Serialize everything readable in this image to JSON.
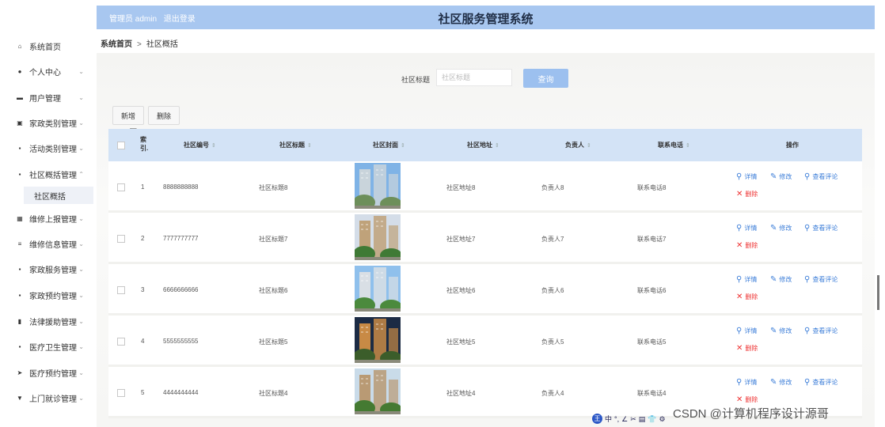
{
  "header": {
    "admin_label": "管理员 admin",
    "logout": "退出登录",
    "title": "社区服务管理系统"
  },
  "breadcrumb": {
    "home": "系统首页",
    "separator": ">",
    "current": "社区概括"
  },
  "sidebar": {
    "items": [
      {
        "label": "系统首页",
        "icon": "home-icon",
        "glyph": "⌂",
        "chevron": ""
      },
      {
        "label": "个人中心",
        "icon": "user-icon",
        "glyph": "●",
        "chevron": "⌄"
      },
      {
        "label": "用户管理",
        "icon": "users-icon",
        "glyph": "▬",
        "chevron": "⌄"
      },
      {
        "label": "家政类别管理",
        "icon": "clipboard-icon",
        "glyph": "▣",
        "chevron": "⌄"
      },
      {
        "label": "活动类别管理",
        "icon": "grid-icon",
        "glyph": "▪",
        "chevron": "⌄"
      },
      {
        "label": "社区概括管理",
        "icon": "grid-icon",
        "glyph": "▪",
        "chevron": "⌃"
      },
      {
        "label": "维修上报管理",
        "icon": "table-icon",
        "glyph": "▦",
        "chevron": "⌄"
      },
      {
        "label": "维修信息管理",
        "icon": "sliders-icon",
        "glyph": "≡",
        "chevron": "⌄"
      },
      {
        "label": "家政服务管理",
        "icon": "grid-icon",
        "glyph": "▪",
        "chevron": "⌄"
      },
      {
        "label": "家政预约管理",
        "icon": "grid-icon",
        "glyph": "▪",
        "chevron": "⌄"
      },
      {
        "label": "法律援助管理",
        "icon": "chart-icon",
        "glyph": "▮",
        "chevron": "⌄"
      },
      {
        "label": "医疗卫生管理",
        "icon": "grid-icon",
        "glyph": "▪",
        "chevron": "⌄"
      },
      {
        "label": "医疗预约管理",
        "icon": "send-icon",
        "glyph": "➤",
        "chevron": "⌄"
      },
      {
        "label": "上门就诊管理",
        "icon": "stamp-icon",
        "glyph": "▼",
        "chevron": "⌄"
      }
    ],
    "sub_item": "社区概括"
  },
  "search": {
    "label": "社区标题",
    "placeholder": "社区标题",
    "button": "查询"
  },
  "actions": {
    "add": "新增",
    "delete": "删除"
  },
  "table": {
    "columns": [
      "索引",
      "社区编号",
      "社区标题",
      "社区封面",
      "社区地址",
      "负责人",
      "联系电话",
      "操作"
    ],
    "index_header": [
      "索",
      "引."
    ],
    "rows": [
      {
        "index": "1",
        "code": "8888888888",
        "title": "社区标题8",
        "address": "社区地址8",
        "manager": "负责人8",
        "phone": "联系电话8"
      },
      {
        "index": "2",
        "code": "7777777777",
        "title": "社区标题7",
        "address": "社区地址7",
        "manager": "负责人7",
        "phone": "联系电话7"
      },
      {
        "index": "3",
        "code": "6666666666",
        "title": "社区标题6",
        "address": "社区地址6",
        "manager": "负责人6",
        "phone": "联系电话6"
      },
      {
        "index": "4",
        "code": "5555555555",
        "title": "社区标题5",
        "address": "社区地址5",
        "manager": "负责人5",
        "phone": "联系电话5"
      },
      {
        "index": "5",
        "code": "4444444444",
        "title": "社区标题4",
        "address": "社区地址4",
        "manager": "负责人4",
        "phone": "联系电话4"
      }
    ],
    "ops": {
      "detail": "详情",
      "edit": "修改",
      "comments": "查看评论",
      "remove": "删除"
    }
  },
  "watermark": "CSDN @计算机程序设计源哥",
  "ime_toolbar": [
    "中",
    "°,",
    "∠",
    "✂",
    "▤",
    "👕",
    "⚙"
  ]
}
